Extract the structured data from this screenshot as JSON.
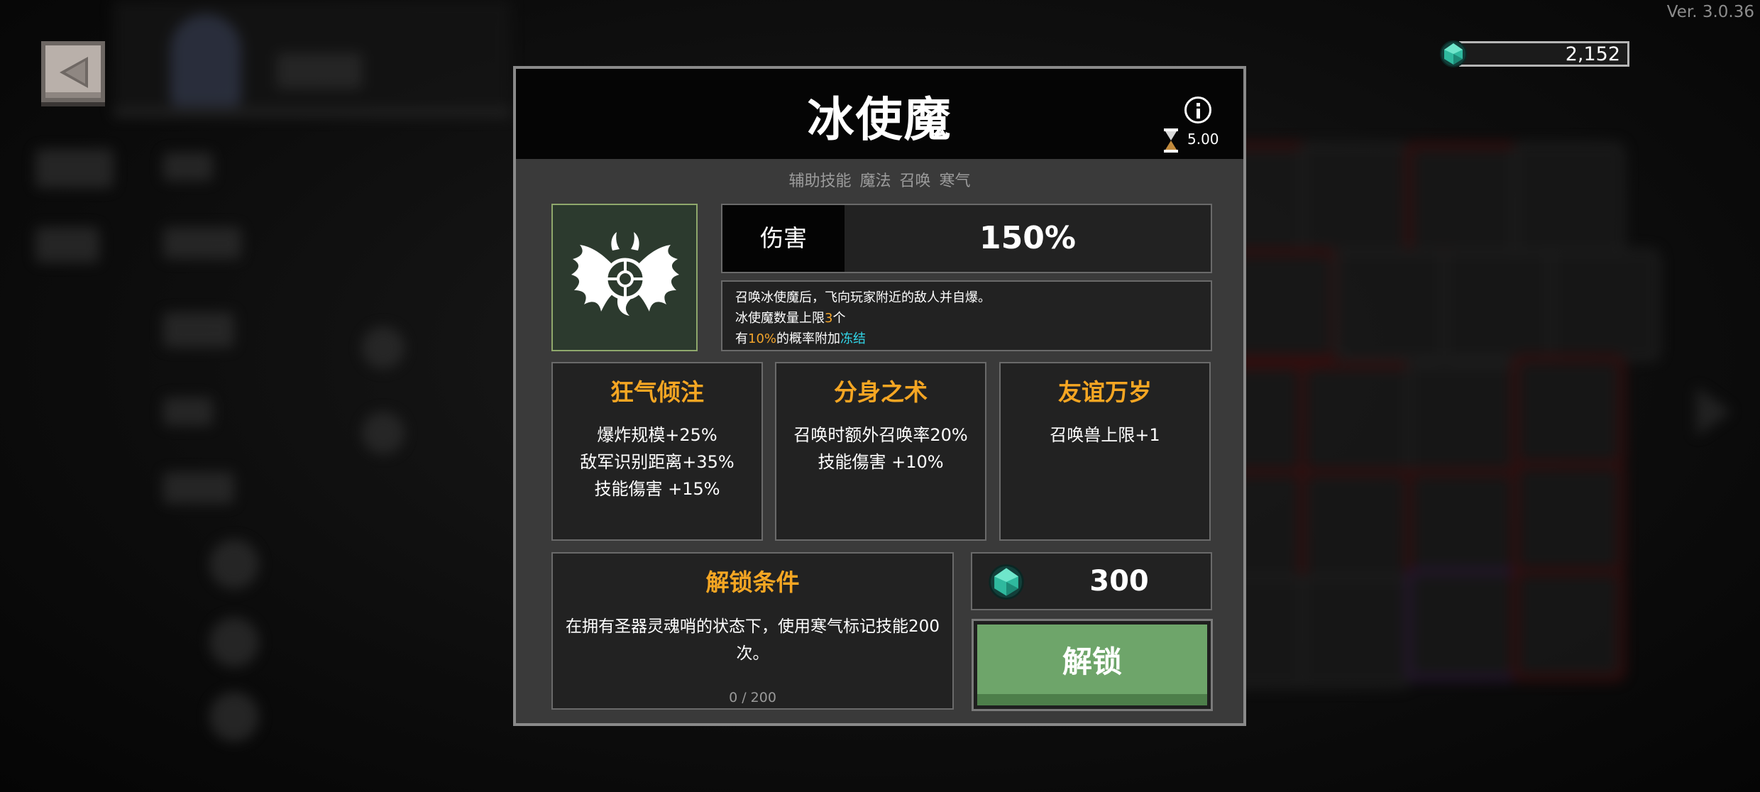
{
  "version": "Ver. 3.0.36",
  "currency": {
    "amount": "2,152",
    "icon": "emerald-gem-icon"
  },
  "back_button": {
    "icon": "back-arrow-icon"
  },
  "skill": {
    "name": "冰使魔",
    "cooldown": "5.00",
    "tags": [
      "辅助技能",
      "魔法",
      "召唤",
      "寒气"
    ],
    "stat": {
      "label": "伤害",
      "value": "150%"
    },
    "description": {
      "line1": "召唤冰使魔后，飞向玩家附近的敌人并自爆。",
      "line2_pre": "冰使魔数量上限",
      "line2_num": "3",
      "line2_post": "个",
      "line3_pre": "有",
      "line3_num": "10%",
      "line3_mid": "的概率附加",
      "line3_effect": "冻结"
    },
    "upgrades": [
      {
        "title": "狂气倾注",
        "lines": [
          "爆炸规模+25%",
          "敌军识别距离+35%",
          "技能傷害 +15%"
        ]
      },
      {
        "title": "分身之术",
        "lines": [
          "召唤时额外召唤率20%",
          "技能傷害 +10%"
        ]
      },
      {
        "title": "友谊万岁",
        "lines": [
          "召唤兽上限+1"
        ]
      }
    ],
    "unlock_condition": {
      "title": "解锁条件",
      "text": "在拥有圣器灵魂哨的状态下，使用寒气标记技能200次。",
      "progress": "0 / 200"
    },
    "cost": "300",
    "unlock_button": "解锁"
  },
  "colors": {
    "accent_orange": "#f5a623",
    "freeze_cyan": "#31d6e8",
    "number_highlight": "#f2a42b",
    "unlock_green": "#6ea56a"
  }
}
